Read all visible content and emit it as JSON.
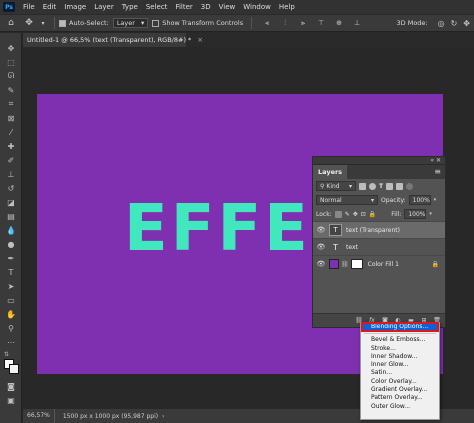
{
  "menubar": {
    "logo": "Ps",
    "items": [
      "File",
      "Edit",
      "Image",
      "Layer",
      "Type",
      "Select",
      "Filter",
      "3D",
      "View",
      "Window",
      "Help"
    ]
  },
  "options_bar": {
    "auto_select_label": "Auto-Select:",
    "auto_select_value": "Layer",
    "show_transform_label": "Show Transform Controls",
    "mode_3d_label": "3D Mode:"
  },
  "document": {
    "tab_title": "Untitled-1 @ 66,5% (text (Transparent), RGB/8#) *",
    "canvas_text": "EFFEC",
    "canvas_color": "#7f30b0",
    "text_color": "#41e7bd"
  },
  "status": {
    "zoom": "66,57%",
    "doc_size": "1500 px x 1000 px (95,987 ppi)"
  },
  "layers_panel": {
    "tab_label": "Layers",
    "filter_select": "Kind",
    "blend_mode": "Normal",
    "opacity_label": "Opacity:",
    "opacity_value": "100%",
    "lock_label": "Lock:",
    "fill_label": "Fill:",
    "fill_value": "100%",
    "layers": [
      {
        "name": "text (Transparent)",
        "type": "smart-text",
        "selected": true
      },
      {
        "name": "text",
        "type": "text",
        "selected": false
      },
      {
        "name": "Color Fill 1",
        "type": "fill",
        "selected": false,
        "fill_color": "#7f30b0",
        "locked": true
      }
    ]
  },
  "context_menu": {
    "items": [
      "Blending Options...",
      "Bevel & Emboss...",
      "Stroke...",
      "Inner Shadow...",
      "Inner Glow...",
      "Satin...",
      "Color Overlay...",
      "Gradient Overlay...",
      "Pattern Overlay...",
      "Outer Glow..."
    ],
    "highlighted_index": 0,
    "highlight_color": "#0a64d8"
  }
}
